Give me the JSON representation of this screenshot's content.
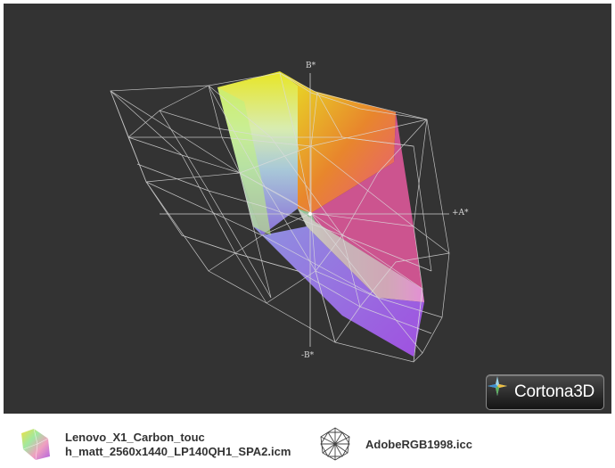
{
  "viewer": {
    "axes": {
      "b_plus": "B*",
      "b_minus": "-B*",
      "a_plus": "+A*"
    },
    "logo_text": "Cortona3D"
  },
  "legend": {
    "items": [
      {
        "icon": "color-gamut-solid-icon",
        "line1": "Lenovo_X1_Carbon_touc",
        "line2": "h_matt_2560x1440_LP140QH1_SPA2.icm"
      },
      {
        "icon": "wireframe-gamut-icon",
        "line1": "AdobeRGB1998.icc"
      }
    ]
  },
  "colors": {
    "viewer_bg": "#333333",
    "wireframe": "#dcdcdc",
    "gamut_yellow": "#e8e624",
    "gamut_orange": "#e8862c",
    "gamut_magenta": "#e040d8",
    "gamut_purple": "#a050e0",
    "gamut_green": "#9ae8a8"
  }
}
